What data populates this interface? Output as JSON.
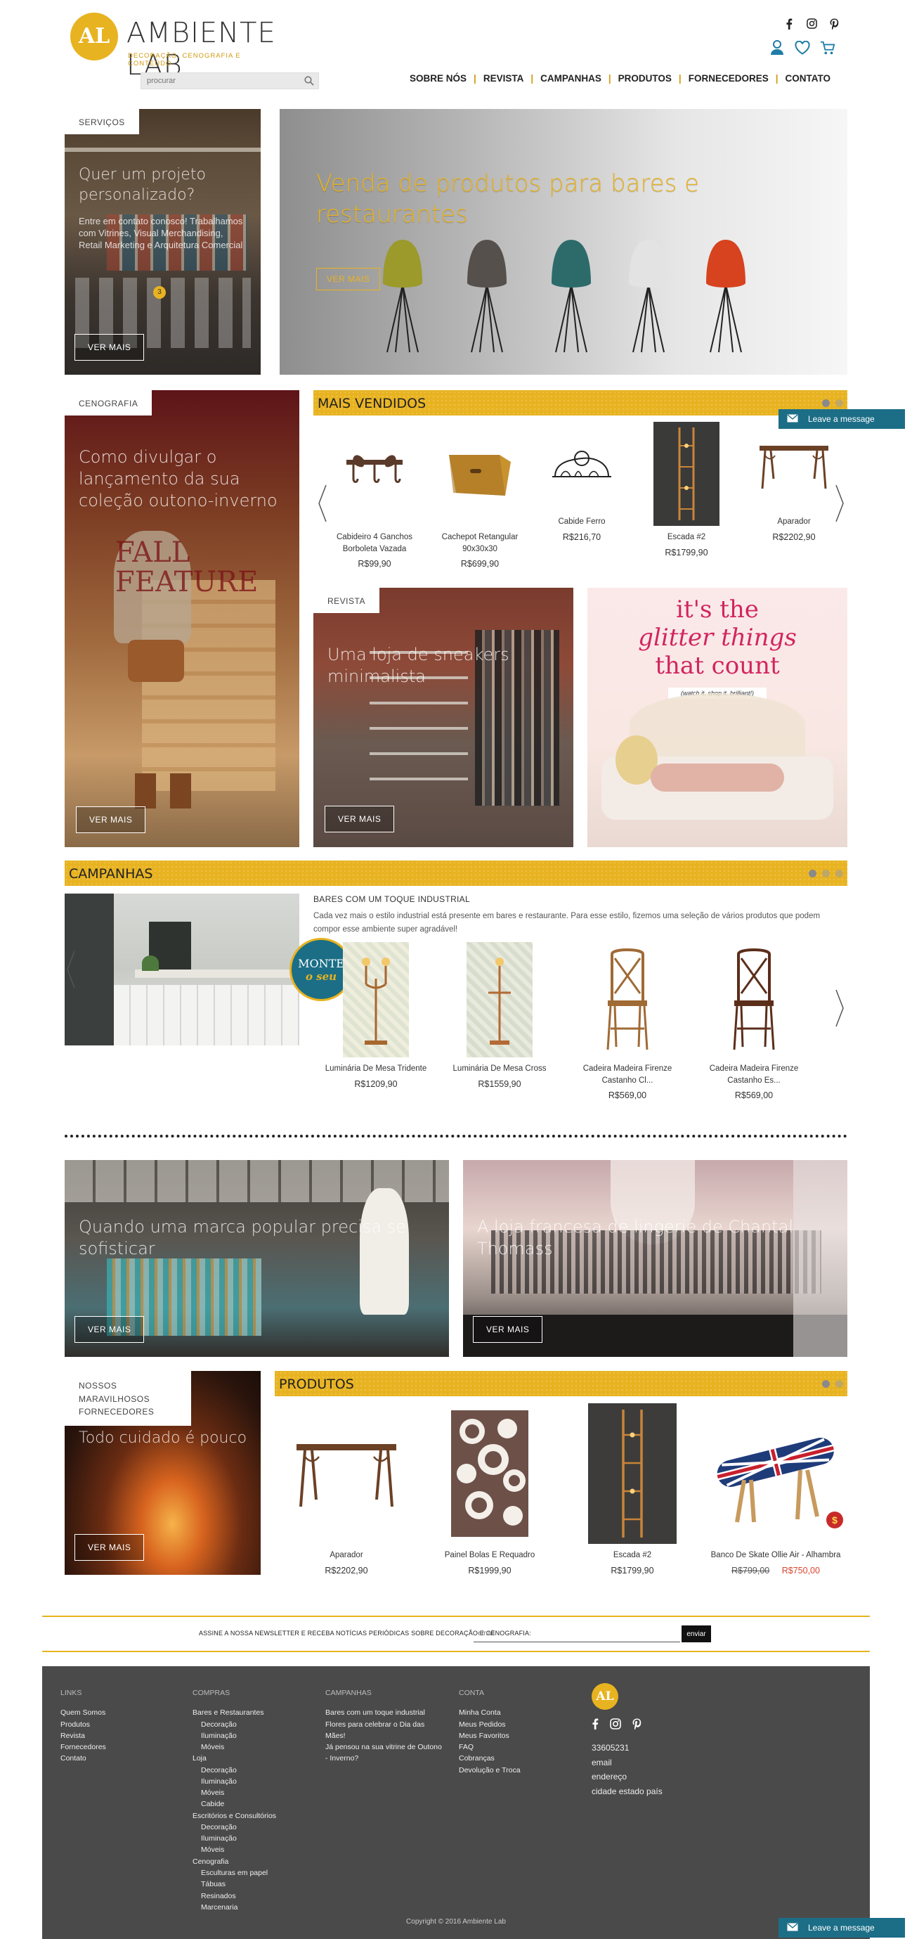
{
  "brand": {
    "logo_mark": "AL",
    "title": "AMBIENTE LAB",
    "subtitle": "DECORAÇÃO, CENOGRAFIA E CONTEÚDO"
  },
  "social": {
    "icons": [
      "facebook-icon",
      "instagram-icon",
      "pinterest-icon"
    ]
  },
  "header_icons": [
    "user-icon",
    "heart-icon",
    "cart-icon"
  ],
  "search": {
    "placeholder": "procurar"
  },
  "nav": {
    "items": [
      "SOBRE NÓS",
      "REVISTA",
      "CAMPANHAS",
      "PRODUTOS",
      "FORNECEDORES",
      "CONTATO"
    ]
  },
  "services": {
    "tab": "SERVIÇOS",
    "title": "Quer um projeto personalizado?",
    "text": "Entre em contato conosco! Trabalhamos com Vitrines, Visual Merchandising, Retail Marketing e Arquitetura Comercial",
    "button": "VER MAIS"
  },
  "hero": {
    "title": "Venda de produtos para bares e restaurantes",
    "button": "VER MAIS"
  },
  "cenografia": {
    "tab": "CENOGRAFIA",
    "title": "Como divulgar o lançamento da sua coleção outono-inverno",
    "button": "VER MAIS",
    "sign_text": "FALL FEATURE"
  },
  "best_sellers": {
    "title": "MAIS VENDIDOS",
    "products": [
      {
        "name": "Cabideiro 4 Ganchos Borboleta Vazada",
        "price": "R$99,90"
      },
      {
        "name": "Cachepot Retangular 90x30x30",
        "price": "R$699,90"
      },
      {
        "name": "Cabide Ferro",
        "price": "R$216,70"
      },
      {
        "name": "Escada #2",
        "price": "R$1799,90"
      },
      {
        "name": "Aparador",
        "price": "R$2202,90"
      }
    ]
  },
  "revista": {
    "tab": "REVISTA",
    "title": "Uma loja de sneakers minimalista",
    "button": "VER MAIS"
  },
  "glitter_ad": {
    "line1": "it's the",
    "line2": "glitter things",
    "line3": "that count",
    "tag": "(watch it. shop it. brilliant!)"
  },
  "campaigns": {
    "title": "CAMPANHAS",
    "badge_top": "MONTE",
    "badge_bottom": "o seu",
    "heading": "BARES COM UM TOQUE INDUSTRIAL",
    "description": "Cada vez mais o estilo industrial está presente em bares e restaurante. Para esse estilo, fizemos uma seleção de vários produtos que podem compor esse ambiente super agradável!",
    "products": [
      {
        "name": "Luminária De Mesa Tridente",
        "price": "R$1209,90"
      },
      {
        "name": "Luminária De Mesa Cross",
        "price": "R$1559,90"
      },
      {
        "name": "Cadeira Madeira Firenze Castanho Cl...",
        "price": "R$569,00"
      },
      {
        "name": "Cadeira Madeira Firenze Castanho Es...",
        "price": "R$569,00"
      }
    ]
  },
  "articles": [
    {
      "title": "Quando uma marca popular precisa se sofisticar",
      "button": "VER MAIS"
    },
    {
      "title": "A loja francesa de lingerie de Chantal Thomass",
      "button": "VER MAIS"
    }
  ],
  "suppliers": {
    "tab": "NOSSOS MARAVILHOSOS FORNECEDORES",
    "title": "Todo cuidado é pouco",
    "button": "VER MAIS"
  },
  "products_section": {
    "title": "PRODUTOS",
    "products": [
      {
        "name": "Aparador",
        "price": "R$2202,90",
        "old_price": ""
      },
      {
        "name": "Painel Bolas E Requadro",
        "price": "R$1999,90",
        "old_price": ""
      },
      {
        "name": "Escada #2",
        "price": "R$1799,90",
        "old_price": ""
      },
      {
        "name": "Banco De Skate Ollie Air - Alhambra",
        "price": "R$750,00",
        "old_price": "R$799,00"
      }
    ],
    "sale_badge": "$"
  },
  "newsletter": {
    "text": "ASSINE A NOSSA NEWSLETTER E RECEBA NOTÍCIAS PERIÓDICAS SOBRE DECORAÇÃO E CENOGRAFIA:",
    "placeholder": "email",
    "button": "enviar"
  },
  "footer": {
    "links": {
      "heading": "LINKS",
      "items": [
        "Quem Somos",
        "Produtos",
        "Revista",
        "Fornecedores",
        "Contato"
      ]
    },
    "compras": {
      "heading": "COMPRAS",
      "items": [
        {
          "label": "Bares e Restaurantes",
          "level": 0
        },
        {
          "label": "Decoração",
          "level": 1
        },
        {
          "label": "Iluminação",
          "level": 1
        },
        {
          "label": "Móveis",
          "level": 1
        },
        {
          "label": "Loja",
          "level": 0
        },
        {
          "label": "Decoração",
          "level": 1
        },
        {
          "label": "Iluminação",
          "level": 1
        },
        {
          "label": "Móveis",
          "level": 1
        },
        {
          "label": "Cabide",
          "level": 1
        },
        {
          "label": "Escritórios e Consultórios",
          "level": 0
        },
        {
          "label": "Decoração",
          "level": 1
        },
        {
          "label": "Iluminação",
          "level": 1
        },
        {
          "label": "Móveis",
          "level": 1
        },
        {
          "label": "Cenografia",
          "level": 0
        },
        {
          "label": "Esculturas em papel",
          "level": 1
        },
        {
          "label": "Tábuas",
          "level": 1
        },
        {
          "label": "Resinados",
          "level": 1
        },
        {
          "label": "Marcenaria",
          "level": 1
        }
      ]
    },
    "campanhas": {
      "heading": "CAMPANHAS",
      "items": [
        "Bares com um toque industrial",
        "Flores para celebrar o Dia das Mães!",
        "Já pensou na sua vitrine de Outono - Inverno?"
      ]
    },
    "conta": {
      "heading": "CONTA",
      "items": [
        "Minha Conta",
        "Meus Pedidos",
        "Meus Favoritos",
        "FAQ",
        "Cobranças",
        "Devolução e Troca"
      ]
    },
    "contact": {
      "phone": "33605231",
      "email": "email",
      "address": "endereço",
      "city": "cidade estado país"
    },
    "copyright": "Copyright © 2016 Ambiente Lab"
  },
  "chat": {
    "label": "Leave a message"
  },
  "colors": {
    "accent": "#e8b320",
    "footer_bg": "#4a4a4a",
    "chat": "#1c6e87",
    "sale": "#d9462f"
  }
}
